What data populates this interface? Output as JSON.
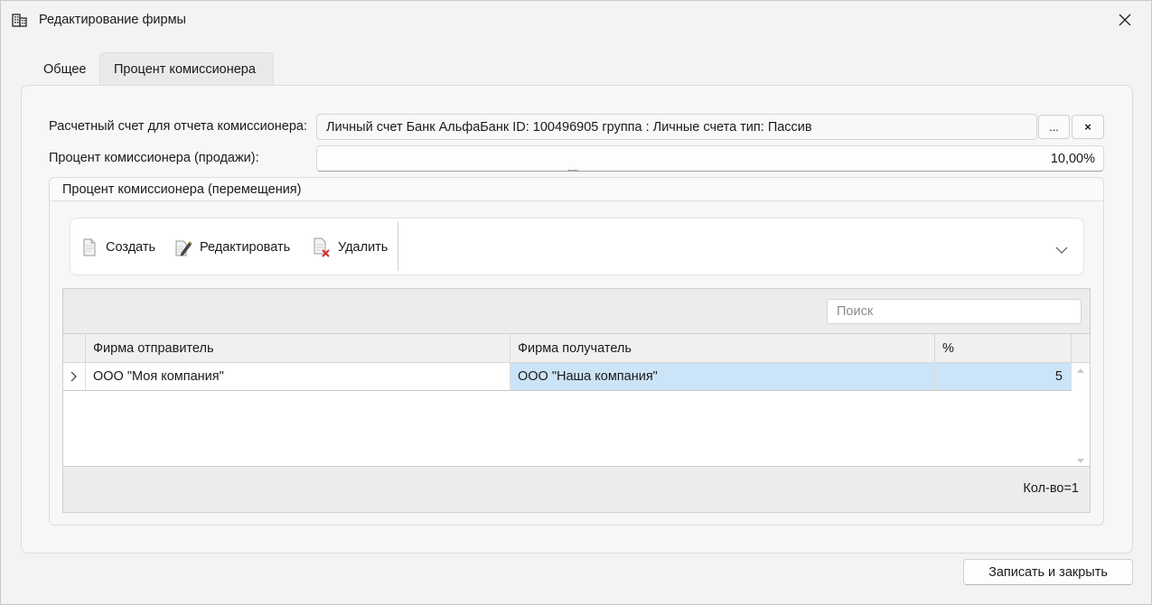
{
  "window": {
    "title": "Редактирование фирмы",
    "icon": "building-icon"
  },
  "tabs": [
    {
      "label": "Общее",
      "active": false
    },
    {
      "label": "Процент комиссионера",
      "active": true
    }
  ],
  "form": {
    "account_label": "Расчетный счет для отчета комиссионера:",
    "account_value": "Личный счет Банк АльфаБанк ID: 100496905 группа : Личные счета тип: Пассив",
    "browse_label": "...",
    "clear_label": "×",
    "percent_label": "Процент комиссионера (продажи):",
    "percent_value": "10,00%"
  },
  "group": {
    "title": "Процент комиссионера (перемещения)"
  },
  "toolbar": {
    "create_label": "Создать",
    "edit_label": "Редактировать",
    "delete_label": "Удалить"
  },
  "grid": {
    "search_placeholder": "Поиск",
    "columns": [
      "Фирма отправитель",
      "Фирма получатель",
      "%"
    ],
    "rows": [
      {
        "sender": "ООО \"Моя компания\"",
        "receiver": "ООО \"Наша компания\"",
        "percent": "5"
      }
    ],
    "count_label": "Кол-во=1"
  },
  "footer": {
    "save_label": "Записать и закрыть"
  },
  "colors": {
    "selection": "#cce4f7",
    "background": "#f3f3f3"
  }
}
